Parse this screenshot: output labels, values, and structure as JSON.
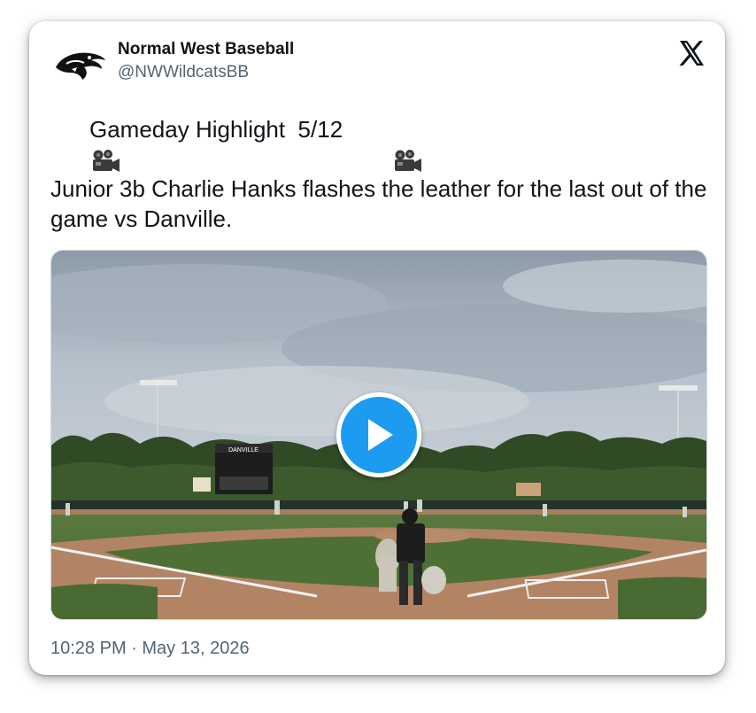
{
  "account": {
    "display_name": "Normal West Baseball",
    "handle": "@NWWildcatsBB"
  },
  "tweet": {
    "line1_text": "Gameday Highlight  5/12",
    "line2_text": "Junior 3b Charlie Hanks flashes the leather for the last out of the game vs Danville."
  },
  "media": {
    "type": "video",
    "scoreboard_text": "DANVILLE"
  },
  "timestamp": "10:28 PM · May 13, 2026",
  "colors": {
    "accent": "#1d9bf0",
    "text": "#0f1419",
    "muted": "#536471"
  },
  "icons": {
    "x_logo": "x-logo-icon",
    "camera": "movie-camera-icon",
    "play": "play-icon",
    "avatar": "wildcat-logo-icon"
  }
}
